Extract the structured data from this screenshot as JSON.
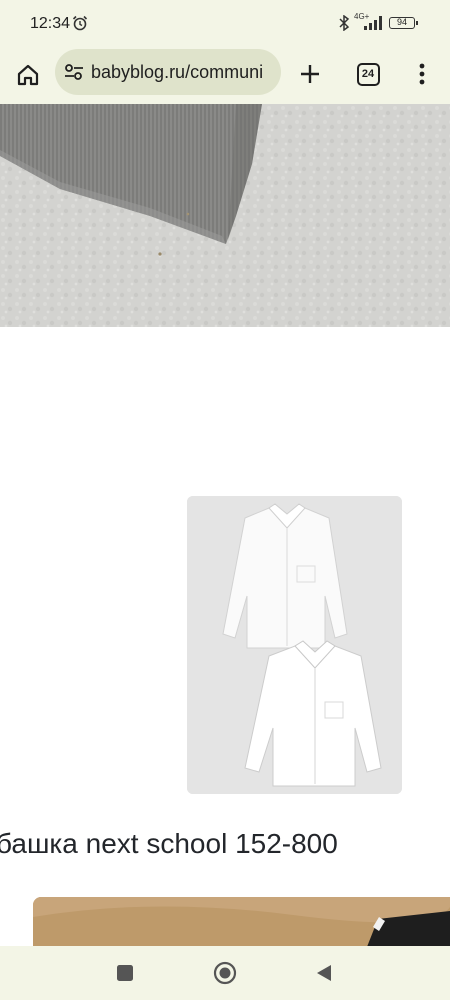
{
  "status_bar": {
    "time": "12:34",
    "network": "4G+",
    "battery": "94",
    "icons": [
      "alarm-icon",
      "bluetooth-icon",
      "signal-icon",
      "battery-icon"
    ]
  },
  "browser": {
    "url": "babyblog.ru/communi",
    "tab_count": "24",
    "icons": [
      "home-icon",
      "site-settings-icon",
      "new-tab-icon",
      "tabs-icon",
      "more-menu-icon"
    ]
  },
  "content": {
    "product_title": "башка next school 152-800"
  },
  "nav_bar": {
    "icons": [
      "recents-icon",
      "home-circle-icon",
      "back-icon"
    ]
  },
  "colors": {
    "chrome_background": "#f3f5e6",
    "url_bar_background": "#dfe3cb",
    "text": "#1f1f1f"
  }
}
